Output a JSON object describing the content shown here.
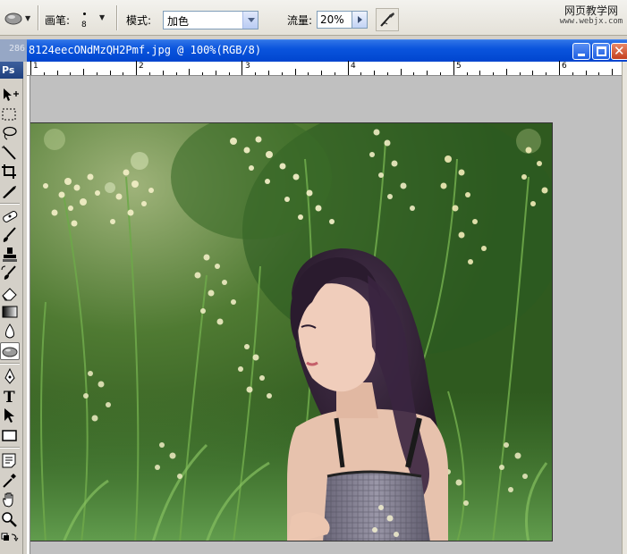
{
  "options_bar": {
    "brush_label": "画笔:",
    "brush_size": "8",
    "mode_label": "模式:",
    "mode_value": "加色",
    "flow_label": "流量:",
    "flow_value": "20%",
    "watermark_line1": "网页教学网",
    "watermark_line2": "www.webjx.com"
  },
  "document": {
    "title": "8124eecONdMzQH2Pmf.jpg @ 100%(RGB/8)",
    "behind_title": "286"
  },
  "ruler": {
    "labels": [
      "1",
      "2",
      "3",
      "4",
      "5",
      "6"
    ]
  },
  "toolbox": {
    "header": "Ps",
    "tools": [
      {
        "name": "move-tool",
        "icon": "move-icon"
      },
      {
        "name": "marquee-tool",
        "icon": "marquee-icon"
      },
      {
        "name": "lasso-tool",
        "icon": "lasso-icon"
      },
      {
        "name": "magic-wand-tool",
        "icon": "magic-wand-icon"
      },
      {
        "name": "crop-tool",
        "icon": "crop-icon"
      },
      {
        "name": "slice-tool",
        "icon": "slice-icon"
      },
      {
        "name": "healing-brush-tool",
        "icon": "bandage-icon"
      },
      {
        "name": "brush-tool",
        "icon": "brush-icon"
      },
      {
        "name": "clone-stamp-tool",
        "icon": "stamp-icon"
      },
      {
        "name": "history-brush-tool",
        "icon": "history-brush-icon"
      },
      {
        "name": "eraser-tool",
        "icon": "eraser-icon"
      },
      {
        "name": "gradient-tool",
        "icon": "gradient-icon"
      },
      {
        "name": "blur-tool",
        "icon": "blur-drop-icon"
      },
      {
        "name": "dodge-tool",
        "icon": "sponge-icon"
      },
      {
        "name": "pen-tool",
        "icon": "pen-icon"
      },
      {
        "name": "type-tool",
        "icon": "type-icon"
      },
      {
        "name": "path-selection-tool",
        "icon": "arrow-icon"
      },
      {
        "name": "shape-tool",
        "icon": "rectangle-icon"
      },
      {
        "name": "notes-tool",
        "icon": "note-icon"
      },
      {
        "name": "eyedropper-tool",
        "icon": "eyedropper-icon"
      },
      {
        "name": "hand-tool",
        "icon": "hand-icon"
      },
      {
        "name": "zoom-tool",
        "icon": "zoom-icon"
      },
      {
        "name": "color-swap",
        "icon": "swap-colors-icon"
      }
    ]
  }
}
